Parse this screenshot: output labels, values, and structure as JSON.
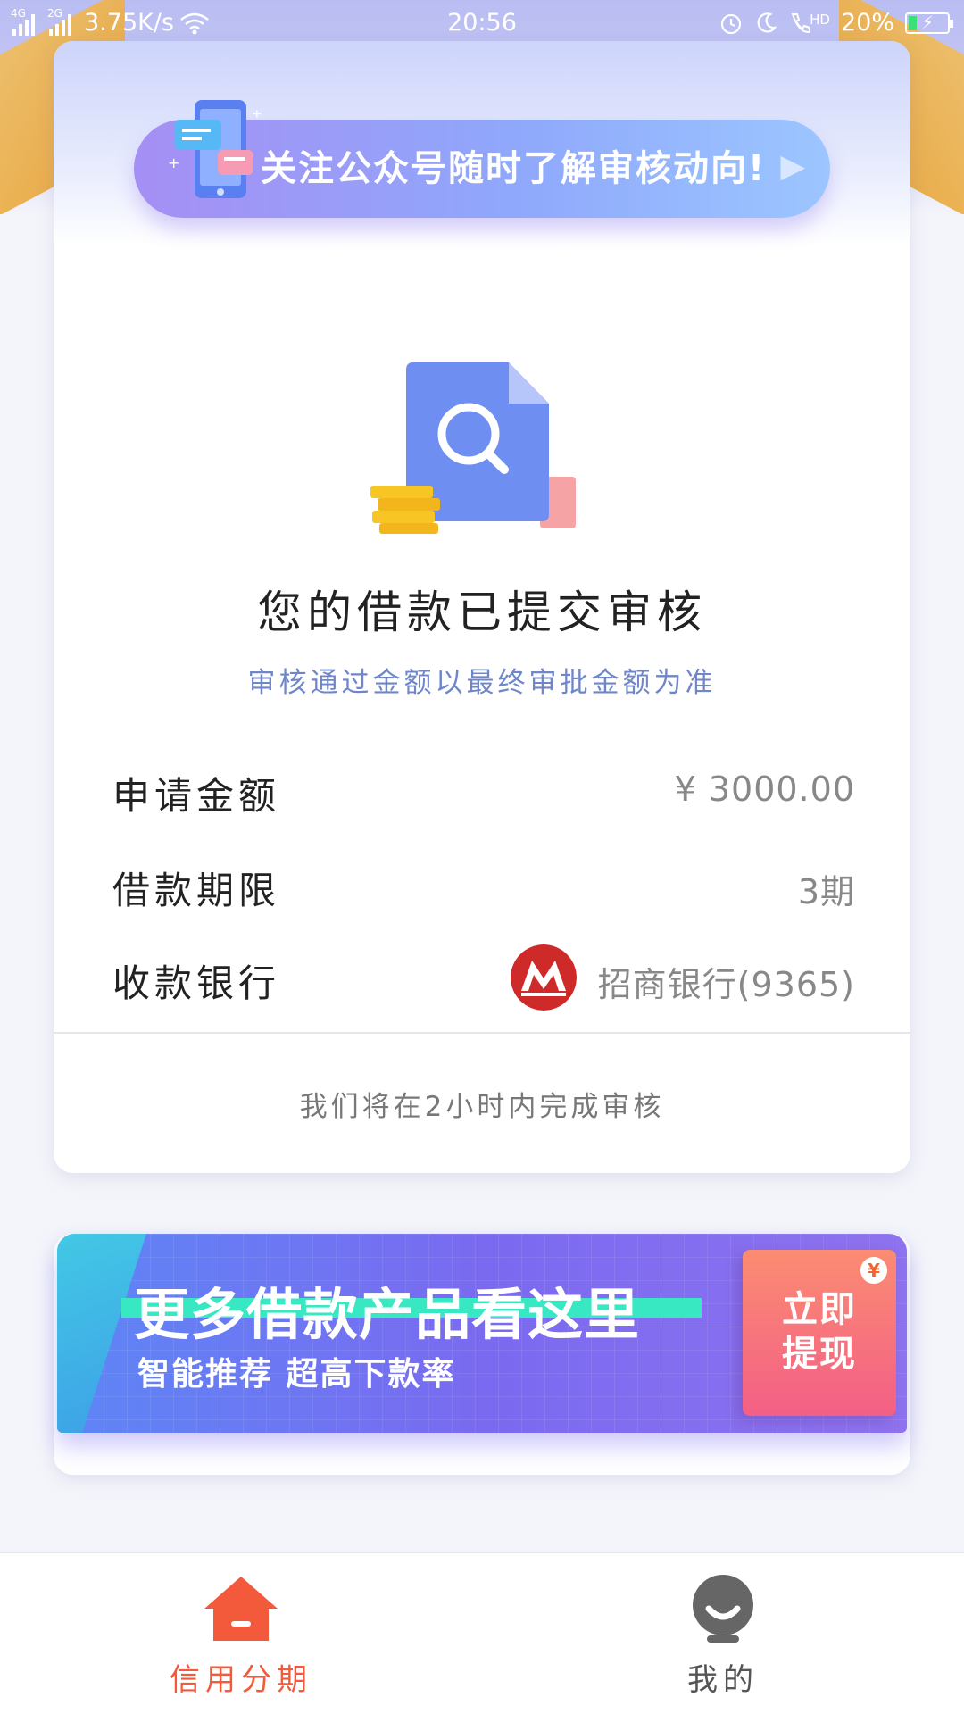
{
  "status_bar": {
    "network_1": "4G",
    "network_2": "2G",
    "speed": "3.75K/s",
    "time": "20:56",
    "hd": "HD",
    "battery": "20%"
  },
  "follow_banner": {
    "text": "关注公众号随时了解审核动向!"
  },
  "status": {
    "title": "您的借款已提交审核",
    "subtitle": "审核通过金额以最终审批金额为准"
  },
  "details": [
    {
      "label": "申请金额",
      "value": "¥ 3000.00"
    },
    {
      "label": "借款期限",
      "value": "3期"
    },
    {
      "label": "收款银行",
      "value": "招商银行(9365)"
    }
  ],
  "footnote": "我们将在2小时内完成审核",
  "promo": {
    "title": "更多借款产品看这里",
    "subtitle": "智能推荐 超高下款率",
    "button_line1": "立即",
    "button_line2": "提现",
    "coin": "¥"
  },
  "tabbar": [
    {
      "label": "信用分期",
      "icon": "home-icon",
      "active": true
    },
    {
      "label": "我的",
      "icon": "user-icon",
      "active": false
    }
  ],
  "colors": {
    "accent": "#f35a3c",
    "subtitle_blue": "#6f86c8",
    "bank_red": "#cf2a2a",
    "promo_start": "#5d86f6",
    "promo_end": "#8e72ef"
  }
}
